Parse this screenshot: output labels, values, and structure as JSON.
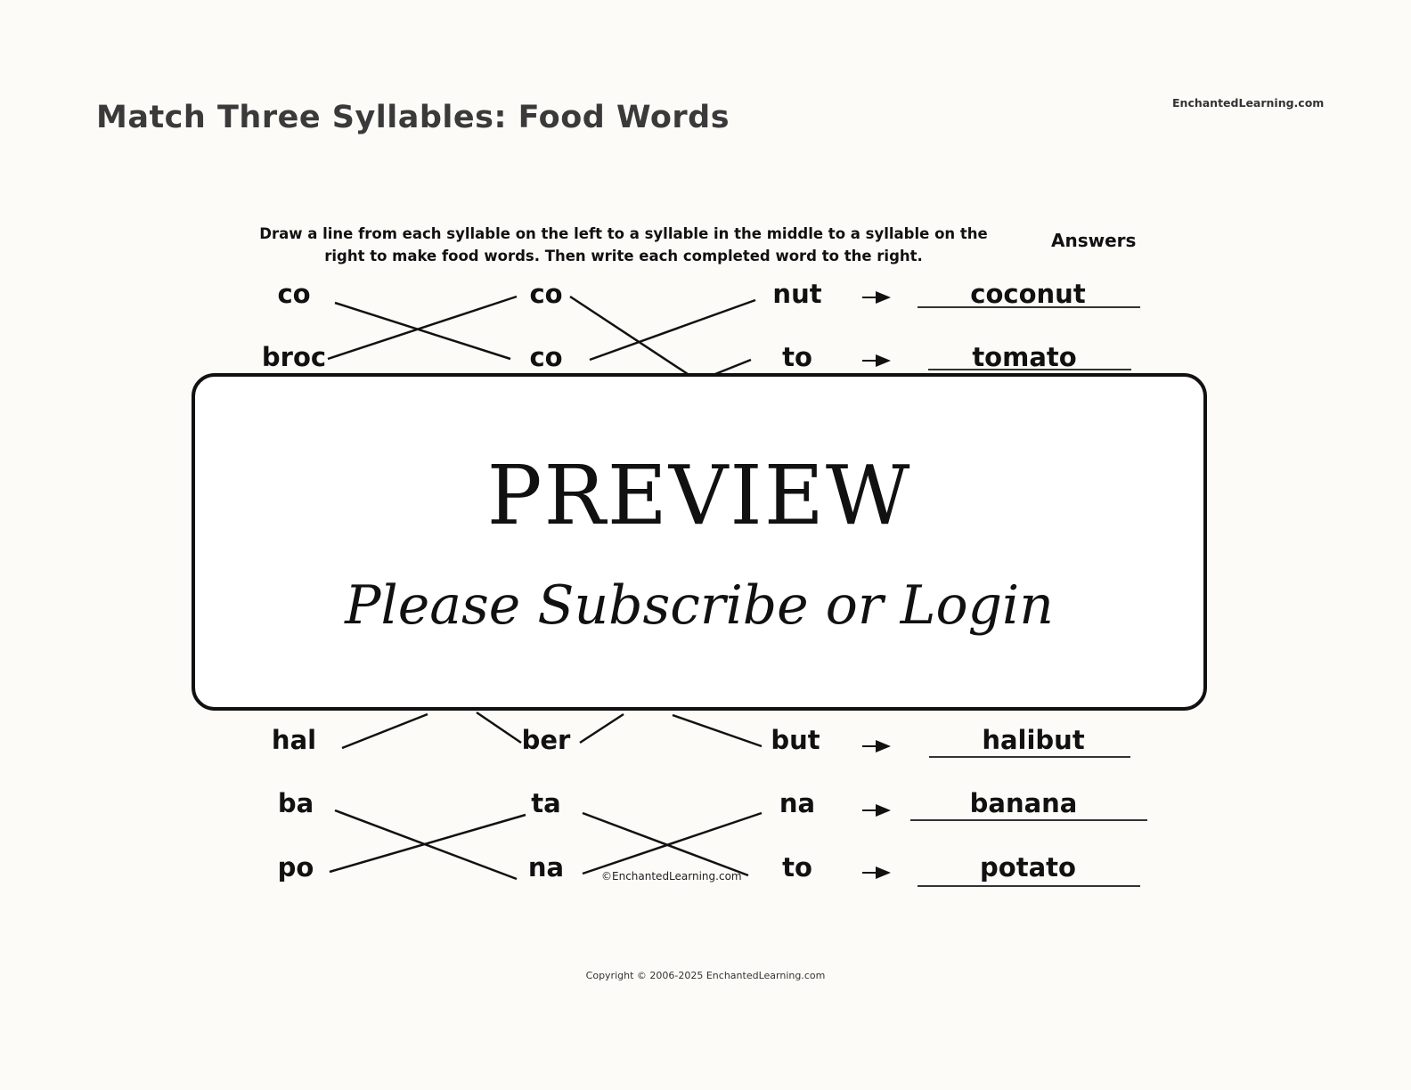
{
  "header": {
    "title": "Match Three Syllables: Food Words",
    "site_label": "EnchantedLearning.com"
  },
  "worksheet": {
    "instructions_line1": "Draw a line from each syllable on the left to a syllable in the middle to a syllable on the",
    "instructions_line2": "right to make food words.  Then write each completed word to the right.",
    "answers_label": "Answers",
    "rows": [
      {
        "left": "co",
        "middle": "co",
        "right": "nut",
        "answer": "coconut"
      },
      {
        "left": "broc",
        "middle": "co",
        "right": "to",
        "answer": "tomato"
      },
      {
        "left": "hal",
        "middle": "ber",
        "right": "but",
        "answer": "halibut"
      },
      {
        "left": "ba",
        "middle": "ta",
        "right": "na",
        "answer": "banana"
      },
      {
        "left": "po",
        "middle": "na",
        "right": "to",
        "answer": "potato"
      }
    ],
    "inline_copyright": "©EnchantedLearning.com"
  },
  "overlay": {
    "heading": "PREVIEW",
    "message": "Please Subscribe or Login"
  },
  "footer": {
    "copyright": "Copyright © 2006-2025 EnchantedLearning.com"
  }
}
